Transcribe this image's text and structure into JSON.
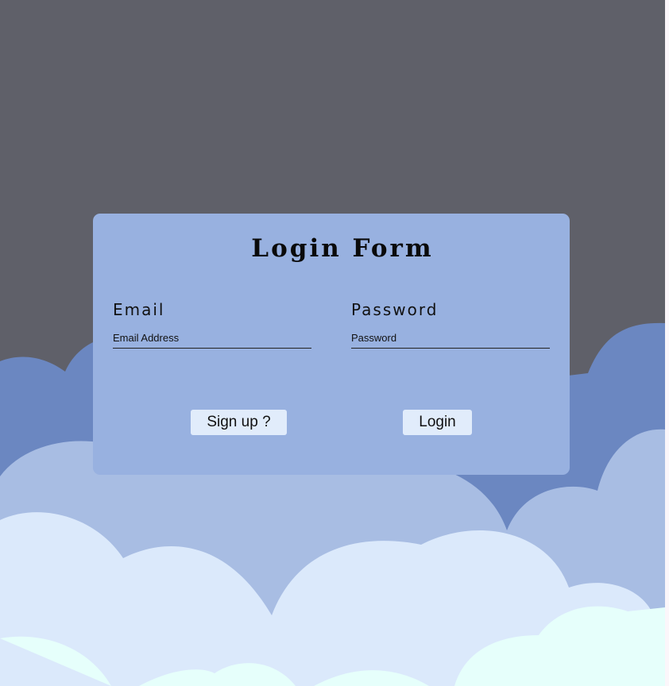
{
  "login_form": {
    "title": "Login Form",
    "email": {
      "label": "Email",
      "placeholder": "Email Address",
      "value": ""
    },
    "password": {
      "label": "Password",
      "placeholder": "Password",
      "value": ""
    },
    "signup_button": "Sign up ?",
    "login_button": "Login"
  },
  "colors": {
    "sky": "#5f6069",
    "cloud_back": "#6b87c1",
    "cloud_mid": "#a8bde3",
    "cloud_front": "#dbe9fb",
    "cloud_foreground": "#e6fffb",
    "card": "#98b1e0",
    "button": "#e1ecfb"
  }
}
